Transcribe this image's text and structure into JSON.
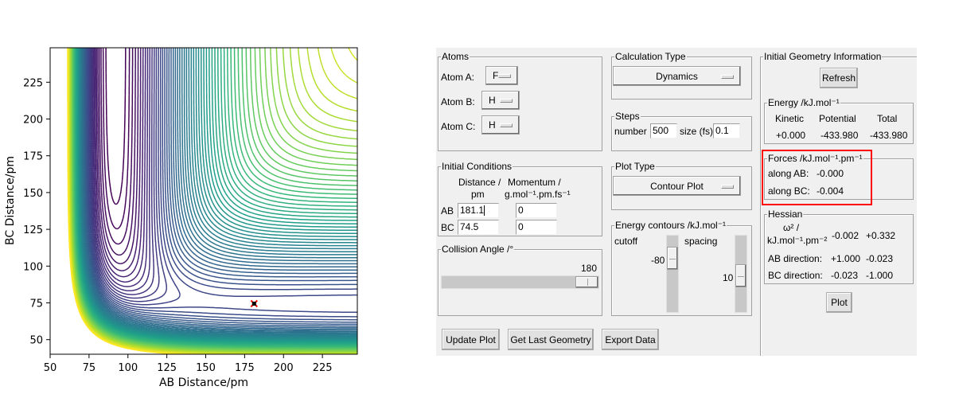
{
  "plot": {
    "xlabel": "AB Distance/pm",
    "ylabel": "BC Distance/pm",
    "xticks": [
      "50",
      "75",
      "100",
      "125",
      "150",
      "175",
      "200",
      "225"
    ],
    "yticks": [
      "50",
      "75",
      "100",
      "125",
      "150",
      "175",
      "200",
      "225"
    ],
    "marker_color": "#ff0000"
  },
  "chart_data": {
    "type": "contour",
    "title": "",
    "xlabel": "AB Distance/pm",
    "ylabel": "BC Distance/pm",
    "xlim": [
      50,
      248
    ],
    "ylim": [
      40,
      248
    ],
    "xticks": [
      50,
      75,
      100,
      125,
      150,
      175,
      200,
      225
    ],
    "yticks": [
      50,
      75,
      100,
      125,
      150,
      175,
      200,
      225
    ],
    "colormap": "viridis",
    "contour_cutoff": -80,
    "contour_spacing": 10,
    "current_point": {
      "x": 181.1,
      "y": 74.5
    }
  },
  "atoms": {
    "title": "Atoms",
    "a_label": "Atom A:",
    "a_value": "F",
    "b_label": "Atom B:",
    "b_value": "H",
    "c_label": "Atom C:",
    "c_value": "H"
  },
  "calc": {
    "title": "Calculation Type",
    "value": "Dynamics"
  },
  "steps": {
    "title": "Steps",
    "number_label": "number",
    "number_value": "500",
    "size_label": "size (fs)",
    "size_value": "0.1"
  },
  "initial": {
    "title": "Initial Conditions",
    "dist_h1": "Distance /",
    "dist_h2": "pm",
    "mom_h1": "Momentum /",
    "mom_h2": "g.mol⁻¹.pm.fs⁻¹",
    "ab_label": "AB",
    "ab_dist": "181.1",
    "ab_mom": "0",
    "bc_label": "BC",
    "bc_dist": "74.5",
    "bc_mom": "0"
  },
  "plottype": {
    "title": "Plot Type",
    "value": "Contour Plot"
  },
  "angle": {
    "title": "Collision Angle /°",
    "value": "180",
    "fraction": 1.0
  },
  "contours": {
    "title": "Energy contours /kJ.mol⁻¹",
    "cutoff_label": "cutoff",
    "cutoff_value": "-80",
    "spacing_label": "spacing",
    "spacing_value": "10"
  },
  "geom": {
    "title": "Initial Geometry Information",
    "refresh": "Refresh",
    "energy_title": "Energy /kJ.mol⁻¹",
    "kinetic_h": "Kinetic",
    "potential_h": "Potential",
    "total_h": "Total",
    "kinetic": "+0.000",
    "potential": "-433.980",
    "total": "-433.980",
    "forces_title": "Forces /kJ.mol⁻¹.pm⁻¹",
    "ab_label": "along AB:",
    "ab_value": "-0.000",
    "bc_label": "along BC:",
    "bc_value": "-0.004",
    "hessian_title": "Hessian",
    "omega_h1": "ω² /",
    "omega_h2": "kJ.mol⁻¹.pm⁻²",
    "eig1": "-0.002",
    "eig2": "+0.332",
    "abdir_label": "AB direction:",
    "abdir1": "+1.000",
    "abdir2": "-0.023",
    "bcdir_label": "BC direction:",
    "bcdir1": "-0.023",
    "bcdir2": "-1.000",
    "plot": "Plot",
    "highlight_color": "#ff0000"
  },
  "buttons": {
    "update": "Update Plot",
    "last": "Get Last Geometry",
    "export": "Export Data"
  }
}
